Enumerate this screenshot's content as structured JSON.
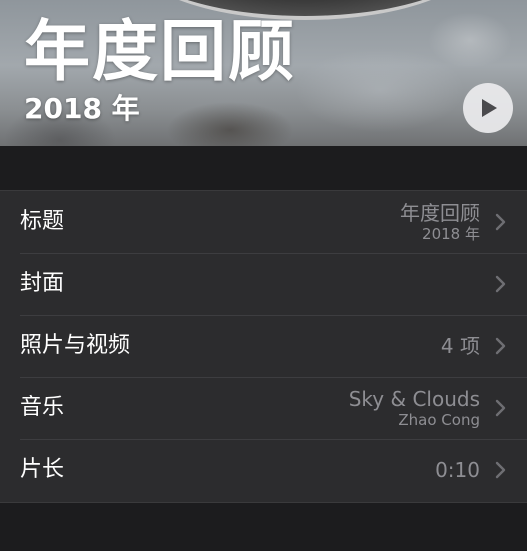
{
  "hero": {
    "title": "年度回顾",
    "subtitle": "2018 年",
    "play_icon": "play-icon"
  },
  "settings": {
    "rows": [
      {
        "label": "标题",
        "value": "年度回顾",
        "sub": "2018 年"
      },
      {
        "label": "封面",
        "value": "",
        "sub": ""
      },
      {
        "label": "照片与视频",
        "value": "4 项",
        "sub": ""
      },
      {
        "label": "音乐",
        "value": "Sky & Clouds",
        "sub": "Zhao Cong"
      },
      {
        "label": "片长",
        "value": "0:10",
        "sub": ""
      }
    ]
  },
  "colors": {
    "background": "#1c1c1e",
    "cell": "#2c2c2e",
    "secondary_text": "#8e8e93",
    "primary_text": "#ffffff"
  }
}
